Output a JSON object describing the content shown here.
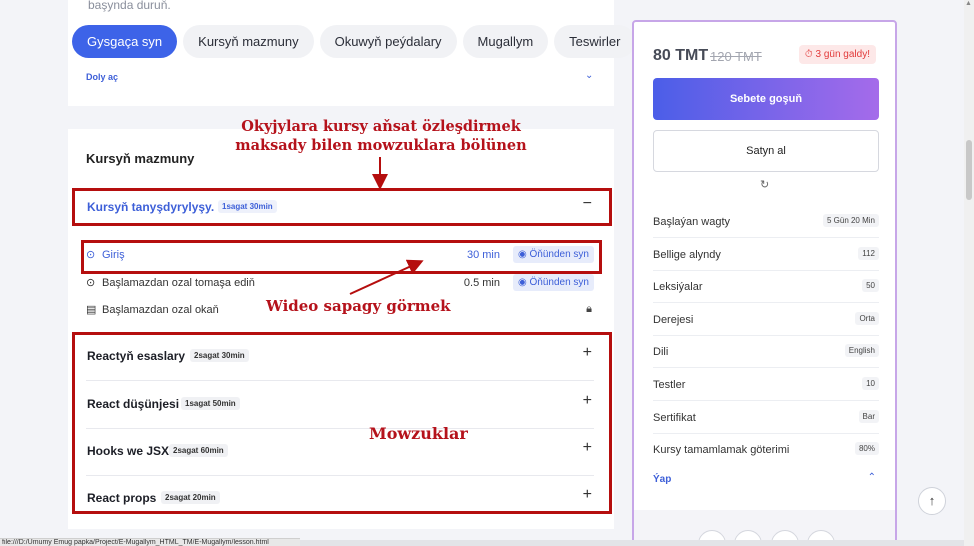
{
  "top_card": {
    "partial_text": "başynda duruň.",
    "tabs": [
      {
        "label": "Gysgaça syn",
        "active": true
      },
      {
        "label": "Kursyň mazmuny",
        "active": false
      },
      {
        "label": "Okuwyň peýdalary",
        "active": false
      },
      {
        "label": "Mugallym",
        "active": false
      },
      {
        "label": "Teswirler",
        "active": false
      }
    ],
    "expand_label": "Doly aç"
  },
  "course_content": {
    "title": "Kursyň mazmuny",
    "sections": [
      {
        "name": "Kursyň tanyşdyrylyşy.",
        "badge": "1sagat 30min",
        "toggle": "−",
        "open": true
      },
      {
        "name": "Reactyň esaslary",
        "badge": "2sagat 30min",
        "toggle": "+"
      },
      {
        "name": "React düşünjesi",
        "badge": "1sagat 50min",
        "toggle": "+"
      },
      {
        "name": "Hooks we JSX",
        "badge": "2sagat 60min",
        "toggle": "+"
      },
      {
        "name": "React props",
        "badge": "2sagat 20min",
        "toggle": "+"
      }
    ],
    "lessons": [
      {
        "label": "Giriş",
        "duration": "30 min",
        "button": "Öňünden syn",
        "icon": "play-circle-icon"
      },
      {
        "label": "Başlamazdan ozal tomaşa ediň",
        "duration": "0.5 min",
        "button": "Öňünden syn",
        "icon": "play-circle-icon"
      },
      {
        "label": "Başlamazdan ozal okaň",
        "icon": "document-icon",
        "locked": true
      }
    ]
  },
  "annotations": {
    "top_note": "Okyjylara kursy aňsat özleşdirmek\nmaksady bilen mowzuklara bölünen",
    "video_note": "Wideo sapagy görmek",
    "topics_note": "Mowzuklar",
    "color": "#b5121b"
  },
  "sidebar": {
    "price": "80 TMT",
    "old_price": "120 TMT",
    "days_left": "3 gün galdy!",
    "primary_button": "Sebete goşuň",
    "secondary_button": "Satyn al",
    "info": [
      {
        "key": "Başlaýan wagty",
        "value": "5 Gün 20 Min"
      },
      {
        "key": "Bellige alyndy",
        "value": "112"
      },
      {
        "key": "Leksiýalar",
        "value": "50"
      },
      {
        "key": "Derejesi",
        "value": "Orta"
      },
      {
        "key": "Dili",
        "value": "English"
      },
      {
        "key": "Testler",
        "value": "10"
      },
      {
        "key": "Sertifikat",
        "value": "Bar"
      },
      {
        "key": "Kursy tamamlamak göterimi",
        "value": "80%"
      }
    ],
    "collapse_label": "Ýap"
  },
  "status_bar": "file:///D:/Umumy Emug papka/Project/E-Mugallym_HTML_TM/E-Mugallym/lesson.html",
  "colors": {
    "accent": "#3d63e8",
    "annotation_red": "#b50e0e",
    "sidebar_border": "#c7a6e8"
  }
}
